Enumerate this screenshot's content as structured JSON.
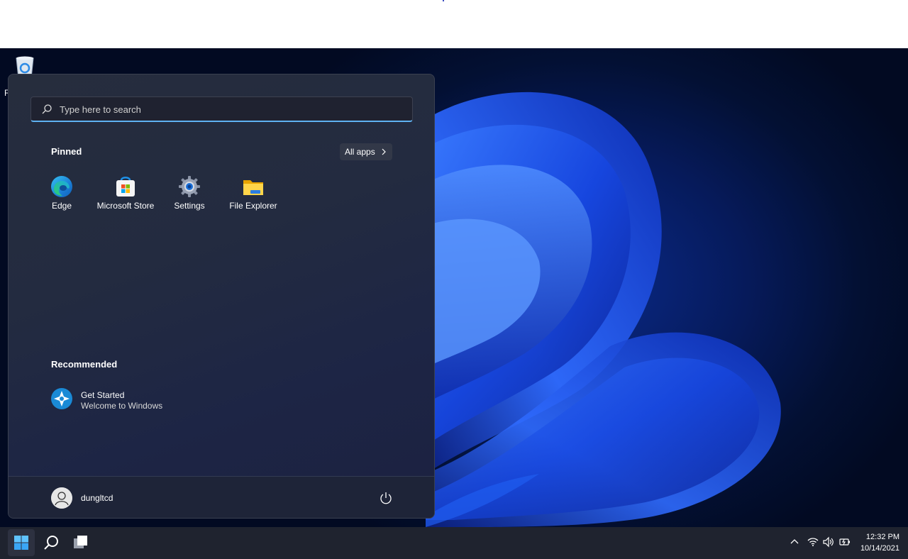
{
  "desktop": {
    "recycle_bin_label": "R"
  },
  "start_menu": {
    "search_placeholder": "Type here to search",
    "pinned_title": "Pinned",
    "all_apps_label": "All apps",
    "pinned_apps": [
      {
        "label": "Edge",
        "icon": "edge-icon"
      },
      {
        "label": "Microsoft Store",
        "icon": "microsoft-store-icon"
      },
      {
        "label": "Settings",
        "icon": "settings-gear-icon"
      },
      {
        "label": "File Explorer",
        "icon": "folder-icon"
      }
    ],
    "recommended_title": "Recommended",
    "recommended_items": [
      {
        "title": "Get Started",
        "subtitle": "Welcome to Windows",
        "icon": "get-started-icon"
      }
    ],
    "user_name": "dungltcd"
  },
  "taskbar": {
    "clock_time": "12:32 PM",
    "clock_date": "10/14/2021",
    "tray_icons": [
      "chevron-up-icon",
      "wifi-icon",
      "volume-icon",
      "battery-icon"
    ]
  },
  "colors": {
    "accent": "#5fb2f2",
    "start_menu_bg": "#232b40",
    "taskbar_bg": "#1f232f"
  }
}
